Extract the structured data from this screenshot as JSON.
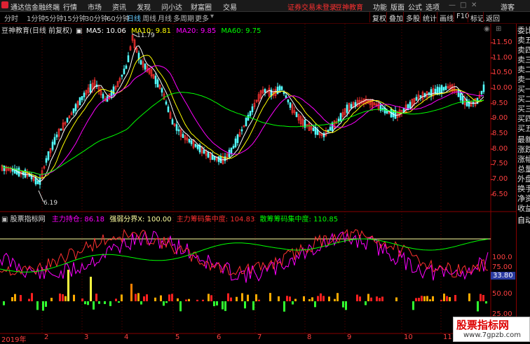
{
  "titlebar": {
    "app_name": "通达信金融终端",
    "menus": [
      "行情",
      "市场",
      "资讯",
      "发现",
      "问小达",
      "财富圈",
      "交易"
    ],
    "notice": "证券交易未登录",
    "edu": "豆神教育",
    "right_items": [
      "功能",
      "版面",
      "公式",
      "选项"
    ],
    "guest": "游客"
  },
  "toolbar": {
    "tabs": [
      "分时",
      "1分钟",
      "5分钟",
      "15分钟",
      "30分钟",
      "60分钟",
      "日线",
      "周线",
      "月线",
      "多周期",
      "更多"
    ],
    "active_tab": "日线",
    "right_tabs": [
      "复权",
      "叠加",
      "多股",
      "统计",
      "画线",
      "F10",
      "标记",
      "返回"
    ]
  },
  "main_chart": {
    "title": "豆神教育(日线 前复权)",
    "ma5": "MA5: 10.06",
    "ma10": "MA10: 9.81",
    "ma20": "MA20: 9.85",
    "ma60": "MA60: 9.75",
    "high_label": "11.79",
    "low_label": "6.19",
    "y_ticks": [
      "11.50",
      "11.00",
      "10.50",
      "10.00",
      "9.50",
      "9.00",
      "8.50",
      "8.00",
      "7.50",
      "7.00",
      "6.50"
    ]
  },
  "indicator": {
    "title": "股票指标网",
    "main_hold": "主力持仓: 86.18",
    "strong_weak": "强弱分界X: 100.00",
    "main_chip": "主力筹码集中度: 104.83",
    "retail_chip": "散筹筹码集中度: 110.85",
    "y_ticks": [
      "100.0",
      "75.00",
      "50.00",
      "25.00"
    ],
    "current_value": "33.80"
  },
  "x_labels": [
    "2019年",
    "2",
    "3",
    "4",
    "5",
    "6",
    "7",
    "8",
    "9",
    "10",
    "11"
  ],
  "sidebar": {
    "items": [
      "委比",
      "卖五",
      "卖四",
      "卖三",
      "卖二",
      "卖一",
      "买一",
      "买二",
      "买三",
      "买四",
      "买五",
      "最新",
      "涨跌",
      "涨幅",
      "总量",
      "外盘",
      "换手",
      "净资",
      "收益"
    ],
    "auto": "自动"
  },
  "watermark": {
    "title": "股票指标网",
    "url": "www.7gpzb.com"
  },
  "colors": {
    "up": "#ff3232",
    "down": "#54ffff",
    "ma5": "#ffffff",
    "ma10": "#ffff00",
    "ma20": "#ff00ff",
    "ma60": "#00ff00",
    "axis": "#ff3030"
  }
}
